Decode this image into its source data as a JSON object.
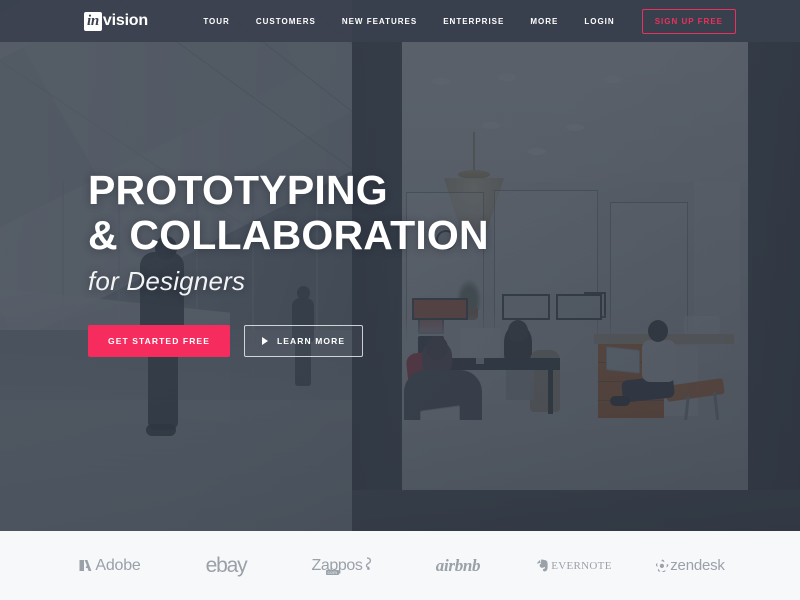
{
  "header": {
    "logo": {
      "mark_text": "in",
      "word_text": "vision",
      "name": "invision"
    },
    "nav_items": [
      {
        "label": "TOUR",
        "name": "nav-tour"
      },
      {
        "label": "CUSTOMERS",
        "name": "nav-customers"
      },
      {
        "label": "NEW FEATURES",
        "name": "nav-new-features"
      },
      {
        "label": "ENTERPRISE",
        "name": "nav-enterprise"
      },
      {
        "label": "MORE",
        "name": "nav-more"
      },
      {
        "label": "LOGIN",
        "name": "nav-login"
      }
    ],
    "signup_label": "SIGN UP FREE",
    "bar_color": "#3A414D",
    "accent_color": "#E8315C"
  },
  "hero": {
    "headline_line1": "PROTOTYPING",
    "headline_line2": "& COLLABORATION",
    "subhead": "for Designers",
    "primary_cta": "GET STARTED FREE",
    "secondary_cta": "LEARN MORE",
    "secondary_icon": "play-icon",
    "primary_color": "#F72C5E",
    "background_description": "modern office interior photo, dark blue-gray overlay"
  },
  "logobar": {
    "background_color": "#F7F8F9",
    "logo_color": "#9AA1A9",
    "brands": [
      {
        "name": "brand-adobe",
        "label": "Adobe",
        "icon": "adobe-a-mark"
      },
      {
        "name": "brand-ebay",
        "label": "ebay",
        "icon": ""
      },
      {
        "name": "brand-zappos",
        "label": "Zappos",
        "icon": "",
        "sub": "com"
      },
      {
        "name": "brand-airbnb",
        "label": "airbnb",
        "icon": ""
      },
      {
        "name": "brand-evernote",
        "label": "EVERNOTE",
        "icon": "elephant-icon"
      },
      {
        "name": "brand-zendesk",
        "label": "zendesk",
        "icon": "pinwheel-icon"
      }
    ]
  }
}
